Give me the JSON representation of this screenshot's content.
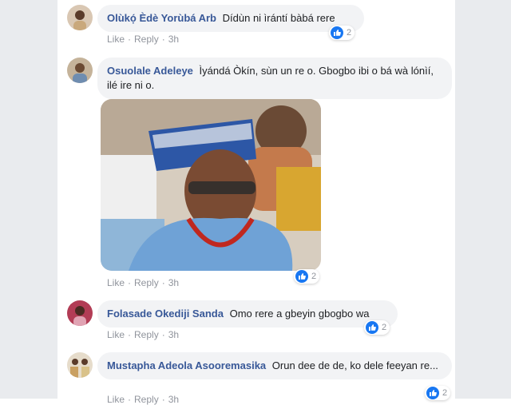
{
  "actions": {
    "like": "Like",
    "reply": "Reply",
    "dot": "·"
  },
  "comments": [
    {
      "author": "Olùkọ́ Èdè Yorùbá Arb",
      "text": "Dídùn ni ìrántí bàbá rere",
      "time": "3h",
      "reactions": "2",
      "reaction_icon": "thumbs-up-icon"
    },
    {
      "author": "Osuolale Adeleye",
      "text": "Ìyándá Òkín, sùn un re o. Gbogbo ibi o bá wà lónìí, ilé ire ni o.",
      "time": "3h",
      "reactions": "2",
      "reaction_icon": "thumbs-up-icon"
    },
    {
      "author": "Folasade Okediji Sanda",
      "text": "Omo rere a gbeyin gbogbo wa",
      "time": "3h",
      "reactions": "2",
      "reaction_icon": "thumbs-up-icon"
    },
    {
      "author": "Mustapha Adeola Asooremasika",
      "text": "Orun dee de de, ko dele feeyan re...",
      "time": "3h",
      "reactions": "2",
      "reaction_icon": "thumbs-up-icon"
    }
  ],
  "colors": {
    "link": "#385898",
    "bubble": "#f2f3f5",
    "like_badge": "#1877f2",
    "meta": "#90949c"
  }
}
